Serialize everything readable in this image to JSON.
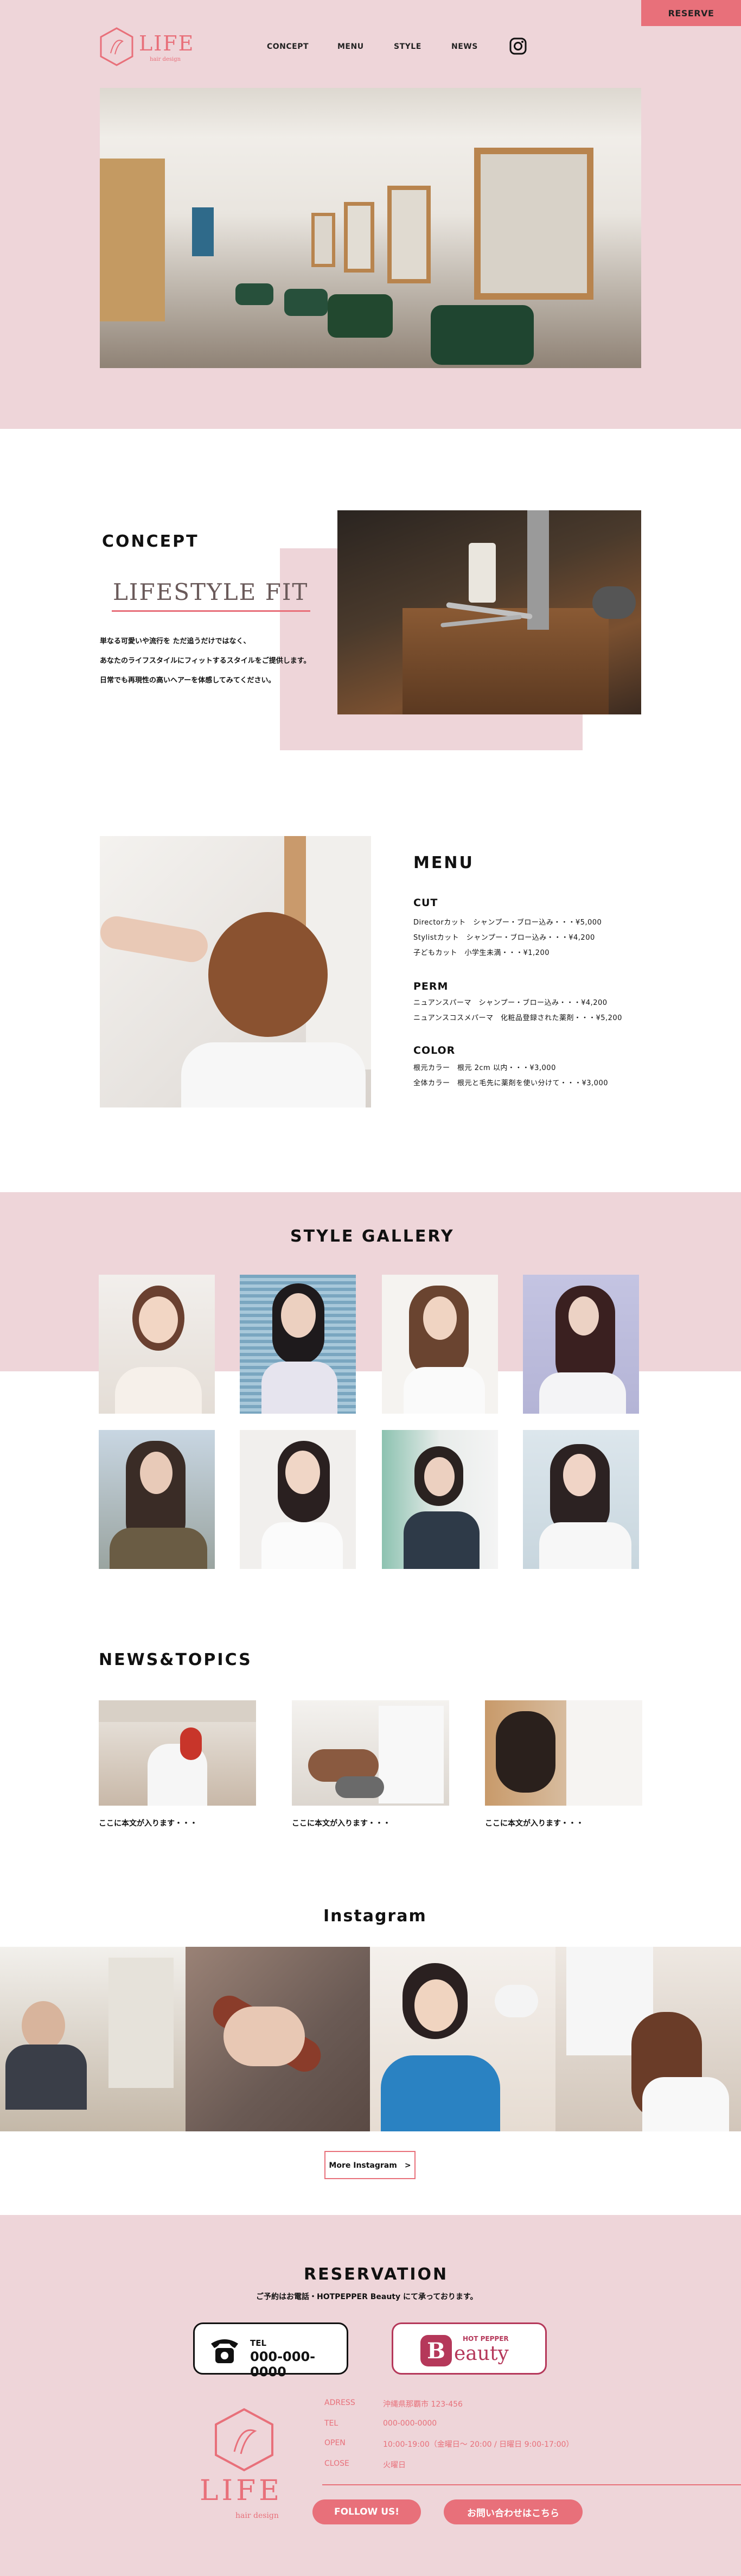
{
  "header": {
    "reserve_label": "RESERVE",
    "logo_text": "LIFE",
    "logo_sub": "hair design",
    "nav": [
      "CONCEPT",
      "MENU",
      "STYLE",
      "NEWS"
    ]
  },
  "concept": {
    "title": "CONCEPT",
    "heading": "LIFESTYLE FIT",
    "body": [
      "単なる可愛いや流行を ただ追うだけではなく、",
      "あなたのライフスタイルにフィットするスタイルをご提供します。",
      "日常でも再現性の高いヘアーを体感してみてください。"
    ]
  },
  "menu": {
    "title": "MENU",
    "groups": [
      {
        "name": "CUT",
        "items": [
          "Directorカット　シャンプー・ブロー込み・・・¥5,000",
          "Stylistカット　シャンプー・ブロー込み・・・¥4,200",
          "子どもカット　小学生未満・・・¥1,200"
        ]
      },
      {
        "name": "PERM",
        "items": [
          "ニュアンスパーマ　シャンプー・ブロー込み・・・¥4,200",
          "ニュアンスコスメパーマ　化粧品登録された薬剤・・・¥5,200"
        ]
      },
      {
        "name": "COLOR",
        "items": [
          "根元カラー　根元 2cm 以内・・・¥3,000",
          "全体カラー　根元と毛先に薬剤を使い分けて・・・¥3,000"
        ]
      }
    ]
  },
  "gallery": {
    "title": "STYLE GALLERY"
  },
  "news": {
    "title": "NEWS&TOPICS",
    "captions": [
      "ここに本文が入ります・・・",
      "ここに本文が入ります・・・",
      "ここに本文が入ります・・・"
    ]
  },
  "instagram": {
    "title": "Instagram",
    "more_label": "More Instagram　>"
  },
  "reservation": {
    "title": "RESERVATION",
    "subtitle": "ご予約はお電話・HOTPEPPER Beauty にて承っております。",
    "tel_label": "TEL",
    "tel_number": "000-000-0000",
    "hotpepper_small": "HOT PEPPER",
    "hotpepper_big": "eauty",
    "hotpepper_b": "B"
  },
  "footer": {
    "logo_text": "LIFE",
    "logo_sub": "hair design",
    "info": [
      {
        "label": "ADRESS",
        "value": "沖縄県那覇市 123-456"
      },
      {
        "label": "TEL",
        "value": "000-000-0000"
      },
      {
        "label": "OPEN",
        "value": "10:00-19:00（金曜日〜 20:00 / 日曜日 9:00-17:00）"
      },
      {
        "label": "CLOSE",
        "value": "火曜日"
      }
    ],
    "follow_label": "FOLLOW US!",
    "contact_label": "お問い合わせはこちら"
  },
  "colors": {
    "accent": "#e8707a",
    "pink_bg": "#eed5d9"
  }
}
